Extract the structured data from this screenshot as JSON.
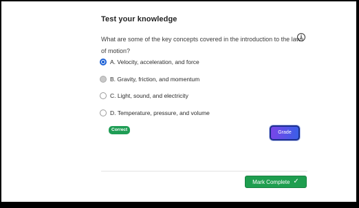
{
  "quiz": {
    "title": "Test your knowledge",
    "question": "What are some of the key concepts covered in the introduction to the laws of motion?",
    "info_icon": "i",
    "options": [
      {
        "label": "A. Velocity, acceleration, and force",
        "state": "selected"
      },
      {
        "label": "B. Gravity, friction, and momentum",
        "state": "gray"
      },
      {
        "label": "C. Light, sound, and electricity",
        "state": "empty"
      },
      {
        "label": "D. Temperature, pressure, and volume",
        "state": "empty"
      }
    ],
    "result_badge": "Correct",
    "grade_label": "Grade"
  },
  "footer": {
    "mark_complete_label": "Mark Complete",
    "check_glyph": "✓"
  },
  "colors": {
    "accent_blue": "#1a5fd6",
    "success_green": "#1e9e4f",
    "grade_gradient_start": "#7a45e8",
    "grade_gradient_end": "#3a5fe8"
  },
  "icons": {
    "info": "info-icon",
    "check": "checkmark-icon"
  }
}
